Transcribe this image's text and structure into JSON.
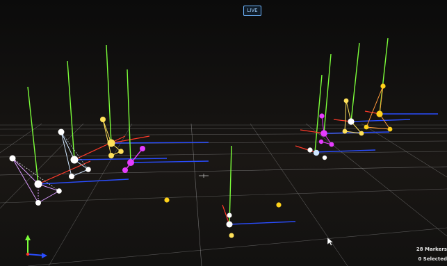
{
  "header": {
    "live_label": "LIVE"
  },
  "status": {
    "markers": "28 Markers",
    "selected": "0 Selected"
  },
  "colors": {
    "background": "#0d0d0d",
    "grid": "#8a8a8a",
    "axis_y": "#7cff3a",
    "axis_x": "#ff3a2a",
    "axis_z": "#2a4dff",
    "marker_white": "#ffffff",
    "marker_yellow": "#ffd21a",
    "marker_magenta": "#e63cff",
    "link_white": "#cfe6ff",
    "link_violet": "#d99bff",
    "link_yellow": "#ffe15a",
    "live_badge": "#6fb6ff"
  },
  "icons": {
    "axis_gizmo": "axes-gizmo-icon",
    "cursor": "mouse-pointer-icon"
  }
}
